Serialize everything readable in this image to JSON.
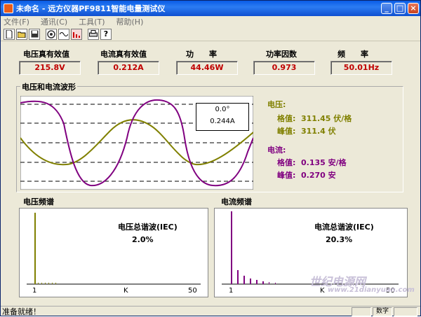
{
  "window": {
    "title": "未命名 - 远方仪器PF9811智能电量测试仪",
    "minimize": "_",
    "maximize": "□",
    "close": "×"
  },
  "menu": [
    "文件(F)",
    "通讯(C)",
    "工具(T)",
    "帮助(H)"
  ],
  "toolbar": {
    "icons": [
      "new-icon",
      "open-icon",
      "save-icon",
      "connect-icon",
      "wave-icon",
      "spectrum-icon",
      "print-icon",
      "help-icon"
    ],
    "help_label": "?"
  },
  "readings": [
    {
      "label": "电压真有效值",
      "value": "215.8V"
    },
    {
      "label": "电流真有效值",
      "value": "0.212A"
    },
    {
      "label": "功　　率",
      "value": "44.46W"
    },
    {
      "label": "功率因数",
      "value": "0.973"
    },
    {
      "label": "频　　率",
      "value": "50.01Hz"
    }
  ],
  "waveform": {
    "title": "电压和电流波形",
    "cursor_angle": "0.0°",
    "cursor_value": "0.244A",
    "voltage": {
      "heading": "电压:",
      "rms_label": "格值:",
      "rms_value": "311.45 伏/格",
      "peak_label": "峰值:",
      "peak_value": "311.4 伏"
    },
    "current": {
      "heading": "电流:",
      "rms_label": "格值:",
      "rms_value": "0.135 安/格",
      "peak_label": "峰值:",
      "peak_value": "0.270 安"
    }
  },
  "voltage_spectrum": {
    "title": "电压频谱",
    "thd_label": "电压总谐波(IEC)",
    "thd_value": "2.0%",
    "axis_start": "1",
    "axis_mid": "K",
    "axis_end": "50"
  },
  "current_spectrum": {
    "title": "电流频谱",
    "thd_label": "电流总谐波(IEC)",
    "thd_value": "20.3%",
    "axis_start": "1",
    "axis_mid": "K",
    "axis_end": "50"
  },
  "status": {
    "text": "准备就绪！",
    "indicator": "数字"
  },
  "watermark": {
    "line1": "世纪电源网",
    "line2": "www.21dianyuan.com"
  },
  "colors": {
    "voltage": "#808000",
    "current": "#800080",
    "reading_value": "#c00000",
    "titlebar": "#0a5ce6"
  }
}
